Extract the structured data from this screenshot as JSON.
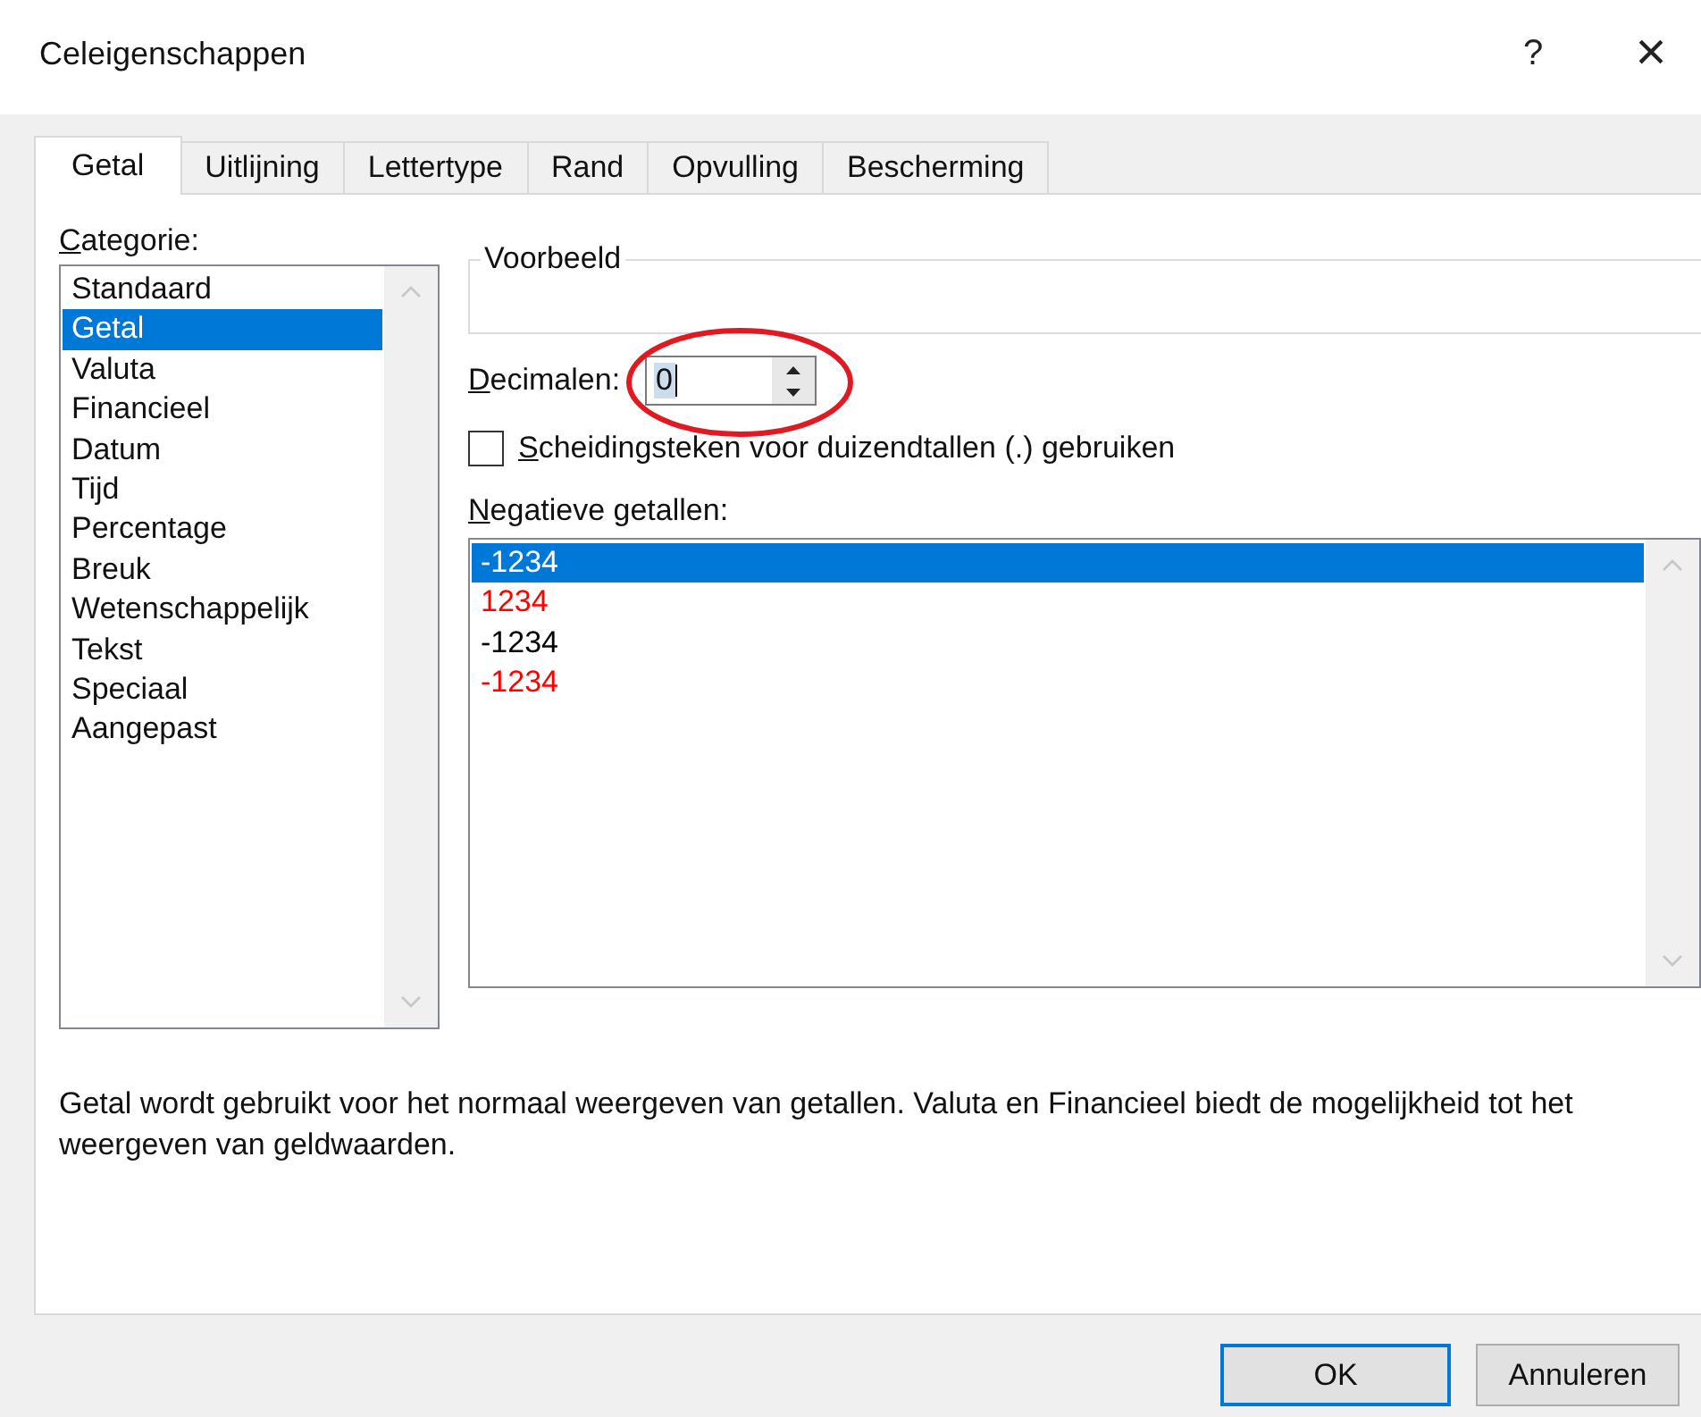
{
  "window": {
    "title": "Celeigenschappen",
    "help": "?",
    "close": "×"
  },
  "tabs": [
    {
      "label": "Getal",
      "selected": true
    },
    {
      "label": "Uitlijning",
      "selected": false
    },
    {
      "label": "Lettertype",
      "selected": false
    },
    {
      "label": "Rand",
      "selected": false
    },
    {
      "label": "Opvulling",
      "selected": false
    },
    {
      "label": "Bescherming",
      "selected": false
    }
  ],
  "category": {
    "label": "Categorie:",
    "items": [
      {
        "label": "Standaard",
        "selected": false
      },
      {
        "label": "Getal",
        "selected": true
      },
      {
        "label": "Valuta",
        "selected": false
      },
      {
        "label": "Financieel",
        "selected": false
      },
      {
        "label": "Datum",
        "selected": false
      },
      {
        "label": "Tijd",
        "selected": false
      },
      {
        "label": "Percentage",
        "selected": false
      },
      {
        "label": "Breuk",
        "selected": false
      },
      {
        "label": "Wetenschappelijk",
        "selected": false
      },
      {
        "label": "Tekst",
        "selected": false
      },
      {
        "label": "Speciaal",
        "selected": false
      },
      {
        "label": "Aangepast",
        "selected": false
      }
    ]
  },
  "sample": {
    "label": "Voorbeeld"
  },
  "decimals": {
    "label": "Decimalen:",
    "value": "0"
  },
  "separator": {
    "label": "Scheidingsteken voor duizendtallen (.) gebruiken",
    "checked": false
  },
  "negative": {
    "label": "Negatieve getallen:",
    "items": [
      {
        "label": "-1234",
        "selected": true
      },
      {
        "label": "1234",
        "color": "#ff0000",
        "selected": false
      },
      {
        "label": "-1234",
        "color": "#000000",
        "selected": false
      },
      {
        "label": "-1234",
        "color": "#ff0000",
        "selected": false
      }
    ]
  },
  "description": "Getal wordt gebruikt voor het normaal weergeven van getallen. Valuta en Financieel biedt de mogelijkheid tot het weergeven van geldwaarden.",
  "buttons": [
    {
      "label": "OK",
      "default": true
    },
    {
      "label": "Annuleren",
      "default": false
    }
  ]
}
